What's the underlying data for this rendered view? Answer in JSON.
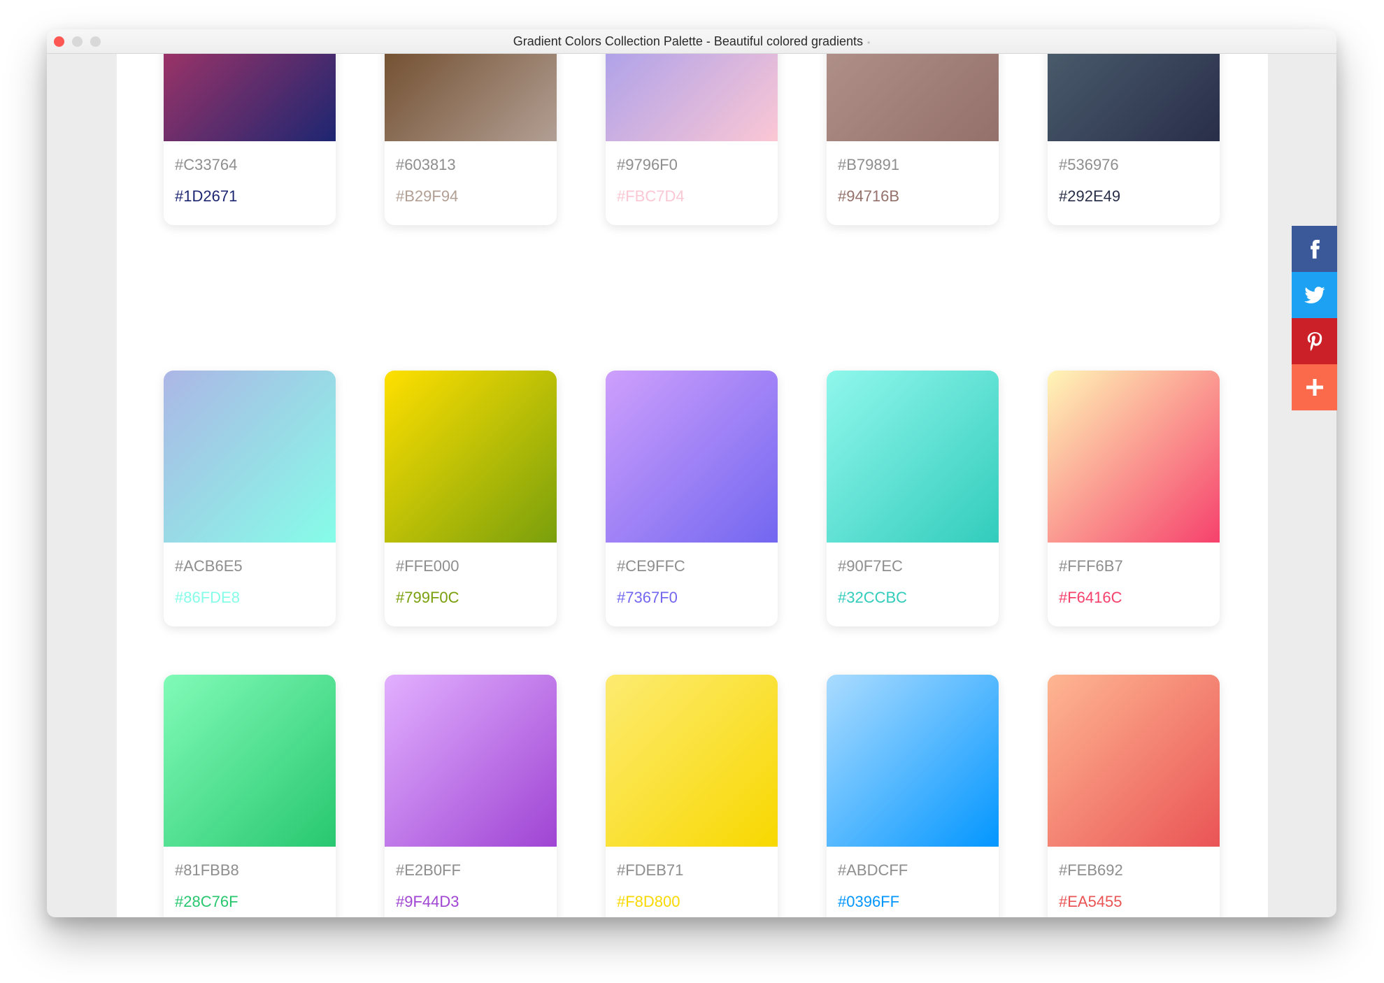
{
  "window": {
    "title": "Gradient Colors Collection Palette - Beautiful colored gradients",
    "title_dot": "•"
  },
  "cards": [
    {
      "from": "#C33764",
      "to": "#1D2671"
    },
    {
      "from": "#603813",
      "to": "#B29F94"
    },
    {
      "from": "#9796F0",
      "to": "#FBC7D4"
    },
    {
      "from": "#B79891",
      "to": "#94716B"
    },
    {
      "from": "#536976",
      "to": "#292E49"
    },
    {
      "from": "#ACB6E5",
      "to": "#86FDE8"
    },
    {
      "from": "#FFE000",
      "to": "#799F0C"
    },
    {
      "from": "#CE9FFC",
      "to": "#7367F0"
    },
    {
      "from": "#90F7EC",
      "to": "#32CCBC"
    },
    {
      "from": "#FFF6B7",
      "to": "#F6416C"
    },
    {
      "from": "#81FBB8",
      "to": "#28C76F"
    },
    {
      "from": "#E2B0FF",
      "to": "#9F44D3"
    },
    {
      "from": "#FDEB71",
      "to": "#F8D800"
    },
    {
      "from": "#ABDCFF",
      "to": "#0396FF"
    },
    {
      "from": "#FEB692",
      "to": "#EA5455"
    }
  ],
  "share": [
    {
      "name": "facebook",
      "icon": "facebook-icon",
      "color": "#3b5998"
    },
    {
      "name": "twitter",
      "icon": "twitter-icon",
      "color": "#1da1f2"
    },
    {
      "name": "pinterest",
      "icon": "pinterest-icon",
      "color": "#cb2027"
    },
    {
      "name": "more",
      "icon": "plus-icon",
      "color": "#fb6a4b"
    }
  ]
}
